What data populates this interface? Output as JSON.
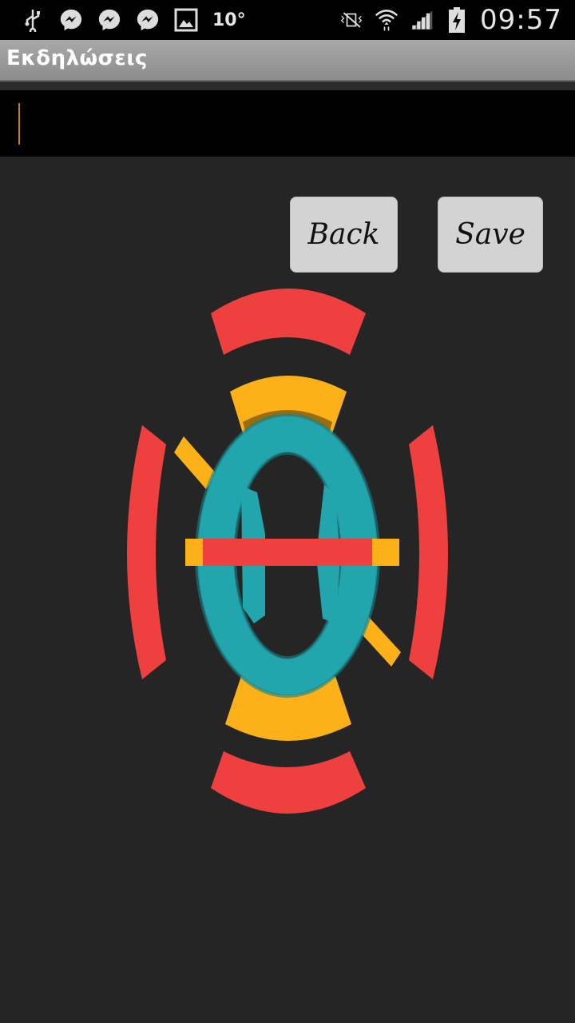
{
  "status_bar": {
    "temperature": "10°",
    "time": "09:57",
    "left_icons": [
      "usb-icon",
      "messenger-icon",
      "messenger-icon",
      "messenger-icon",
      "image-icon"
    ],
    "right_icons": [
      "vibrate-mute-icon",
      "wifi-icon",
      "signal-icon",
      "battery-charging-icon"
    ]
  },
  "app": {
    "title": "Εκδηλώσεις"
  },
  "input": {
    "value": ""
  },
  "buttons": {
    "back": "Back",
    "save": "Save"
  },
  "colors": {
    "red": "#ef4040",
    "yellow": "#fbb117",
    "teal": "#23a5ad",
    "background": "#252525"
  }
}
